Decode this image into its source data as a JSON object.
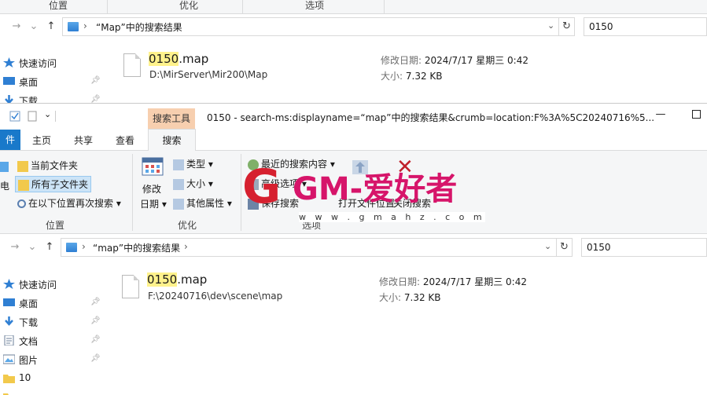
{
  "window1": {
    "ribbon_groups": [
      "位置",
      "优化",
      "选项"
    ],
    "address_path": "“Map”中的搜索结果",
    "search_value": "0150",
    "sidebar": [
      {
        "label": "快速访问",
        "icon": "star-icon"
      },
      {
        "label": "桌面",
        "icon": "desktop-icon"
      },
      {
        "label": "下载",
        "icon": "download-icon"
      }
    ],
    "result": {
      "name_match": "0150",
      "name_rest": ".map",
      "path": "D:\\MirServer\\Mir200\\Map",
      "modified_label": "修改日期:",
      "modified_value": "2024/7/17 星期三 0:42",
      "size_label": "大小:",
      "size_value": "7.32 KB"
    }
  },
  "window2": {
    "context_tab": "搜索工具",
    "title": "0150 - search-ms:displayname=“map”中的搜索结果&crumb=location:F%3A%5C20240716%5...",
    "tabs": {
      "file": "件",
      "home": "主页",
      "share": "共享",
      "view": "查看",
      "search": "搜索"
    },
    "ribbon": {
      "current_folder": "当前文件夹",
      "all_subfolders": "所有子文件夹",
      "search_again": "在以下位置再次搜索",
      "pc_partial": "电",
      "modify_date_1": "修改",
      "modify_date_2": "日期",
      "type": "类型",
      "size": "大小",
      "other_props": "其他属性",
      "recent_searches": "最近的搜索内容",
      "advanced_options": "高级选项",
      "save_search": "保存搜索",
      "open_location": "打开文件位置",
      "close_search": "关闭搜索",
      "group_location": "位置",
      "group_refine": "优化",
      "group_options": "选项"
    },
    "address_path": "“map”中的搜索结果",
    "search_value": "0150",
    "sidebar": [
      {
        "label": "快速访问",
        "icon": "star-icon",
        "pinned": false
      },
      {
        "label": "桌面",
        "icon": "desktop-icon",
        "pinned": true
      },
      {
        "label": "下载",
        "icon": "download-icon",
        "pinned": true
      },
      {
        "label": "文档",
        "icon": "document-icon",
        "pinned": true
      },
      {
        "label": "图片",
        "icon": "pictures-icon",
        "pinned": true
      },
      {
        "label": "10",
        "icon": "folder-icon",
        "pinned": false
      }
    ],
    "result": {
      "name_match": "0150",
      "name_rest": ".map",
      "path": "F:\\20240716\\dev\\scene\\map",
      "modified_label": "修改日期:",
      "modified_value": "2024/7/17 星期三 0:42",
      "size_label": "大小:",
      "size_value": "7.32 KB"
    }
  },
  "watermark": {
    "text": "GM-爱好者",
    "url": "w w w . g m a h z . c o m"
  },
  "colors": {
    "accent": "#1979ca",
    "context_tab": "#f7cfaf",
    "highlight": "#fff28c",
    "watermark": "#d6156a"
  }
}
